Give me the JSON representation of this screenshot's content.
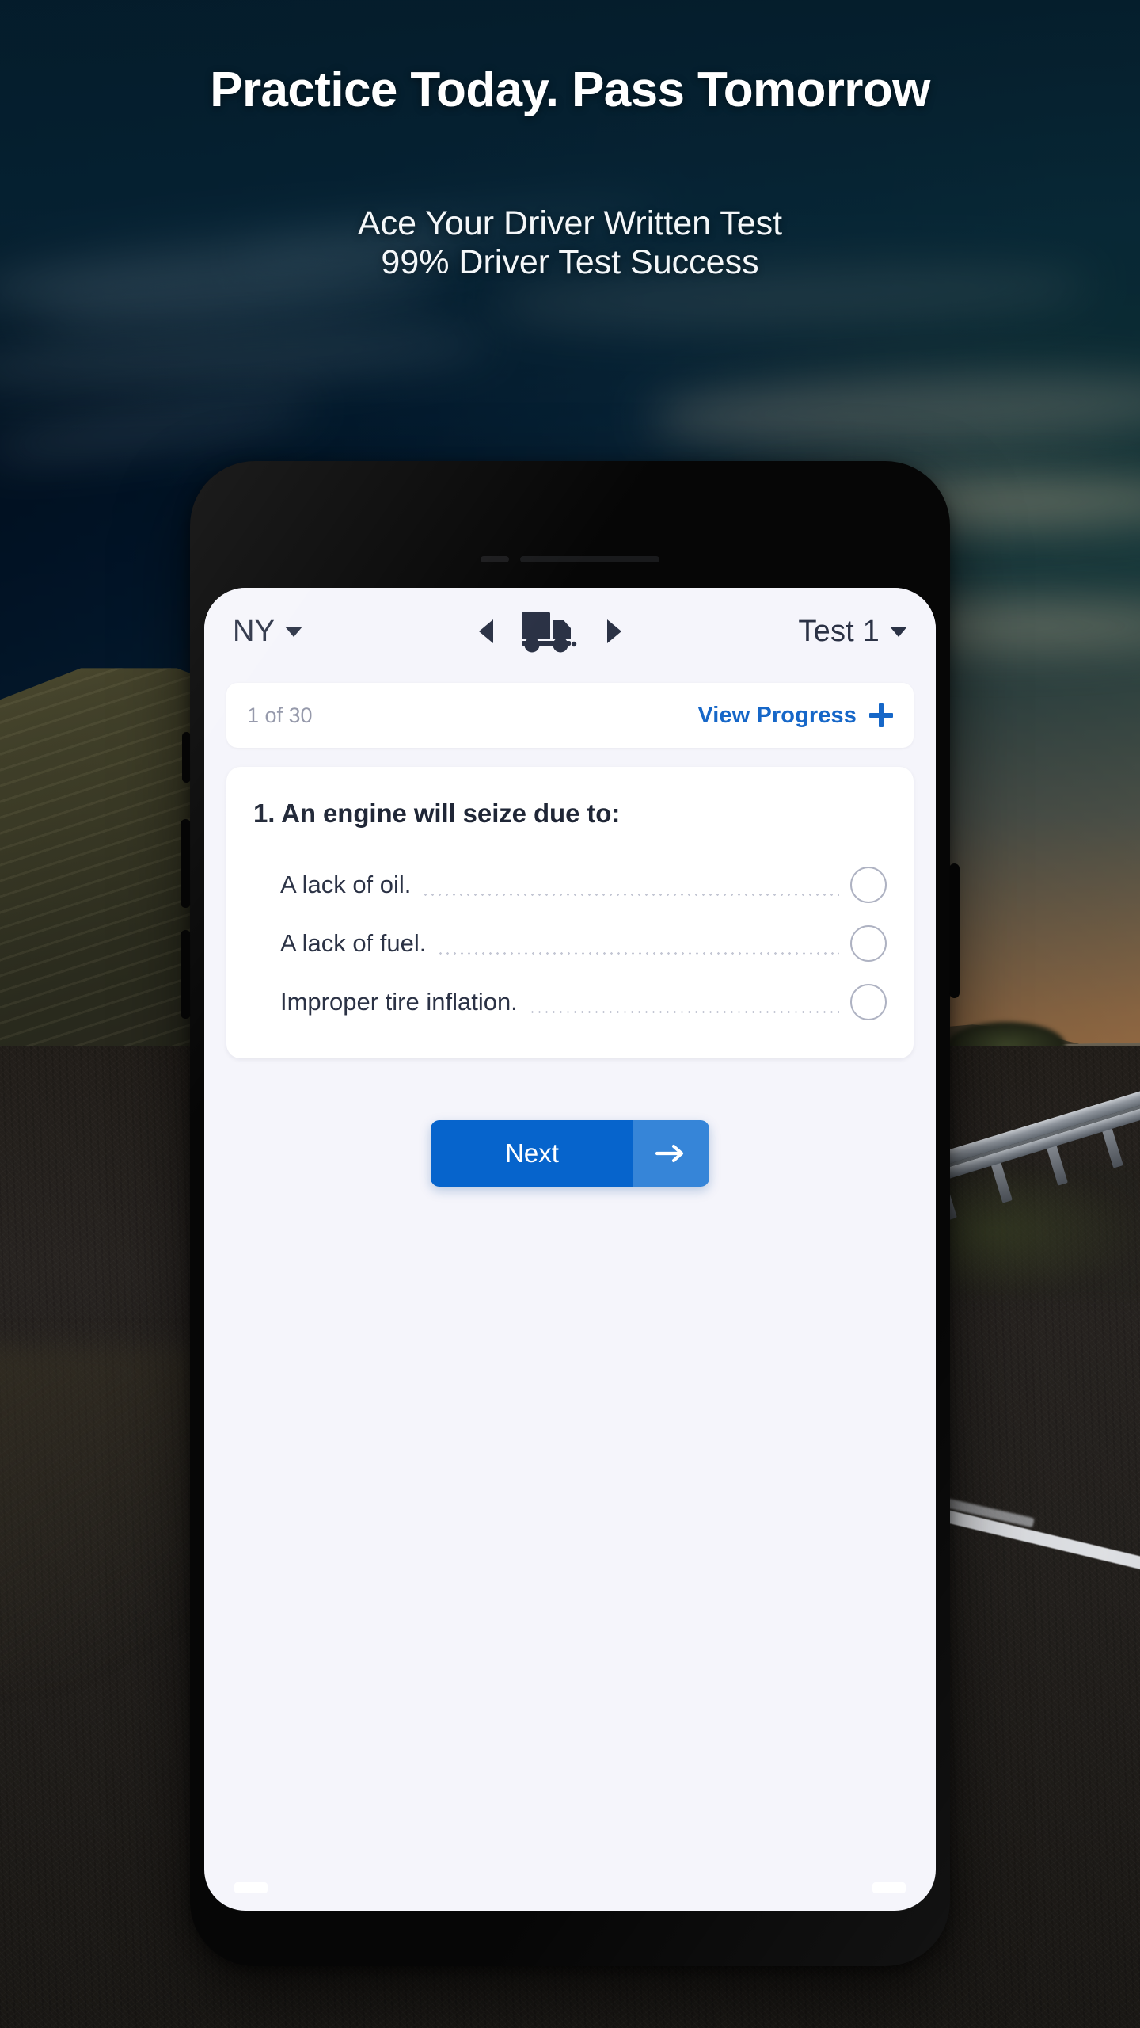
{
  "promo": {
    "headline": "Practice Today. Pass Tomorrow",
    "sub_line_1": "Ace Your Driver Written Test",
    "sub_line_2": "99% Driver Test Success"
  },
  "colors": {
    "primary_blue": "#0664CC",
    "arrow_blue": "#3685D8",
    "link_blue": "#1667C8",
    "ink": "#2B3245",
    "app_bg": "#F5F5FB",
    "card_bg": "#FFFFFF",
    "radio_border": "#AEB2C2",
    "muted_text": "#9296A8"
  },
  "app": {
    "header": {
      "state_selector": {
        "value": "NY",
        "icon": "chevron-down-icon"
      },
      "vehicle_prev_icon": "triangle-left-icon",
      "vehicle_icon": "truck-icon",
      "vehicle_next_icon": "triangle-right-icon",
      "test_selector": {
        "value": "Test 1",
        "icon": "chevron-down-icon"
      }
    },
    "progress_bar": {
      "count_label": "1 of 30",
      "view_progress_label": "View Progress",
      "plus_icon": "plus-icon"
    },
    "question": {
      "number": "1.",
      "text": "An engine will seize due to:",
      "full_title": "1. An engine will seize due to:",
      "options": [
        {
          "label": "A lack of oil.",
          "selected": false
        },
        {
          "label": "A lack of fuel.",
          "selected": false
        },
        {
          "label": "Improper tire inflation.",
          "selected": false
        }
      ]
    },
    "next_button": {
      "label": "Next",
      "arrow_icon": "arrow-right-icon"
    }
  }
}
